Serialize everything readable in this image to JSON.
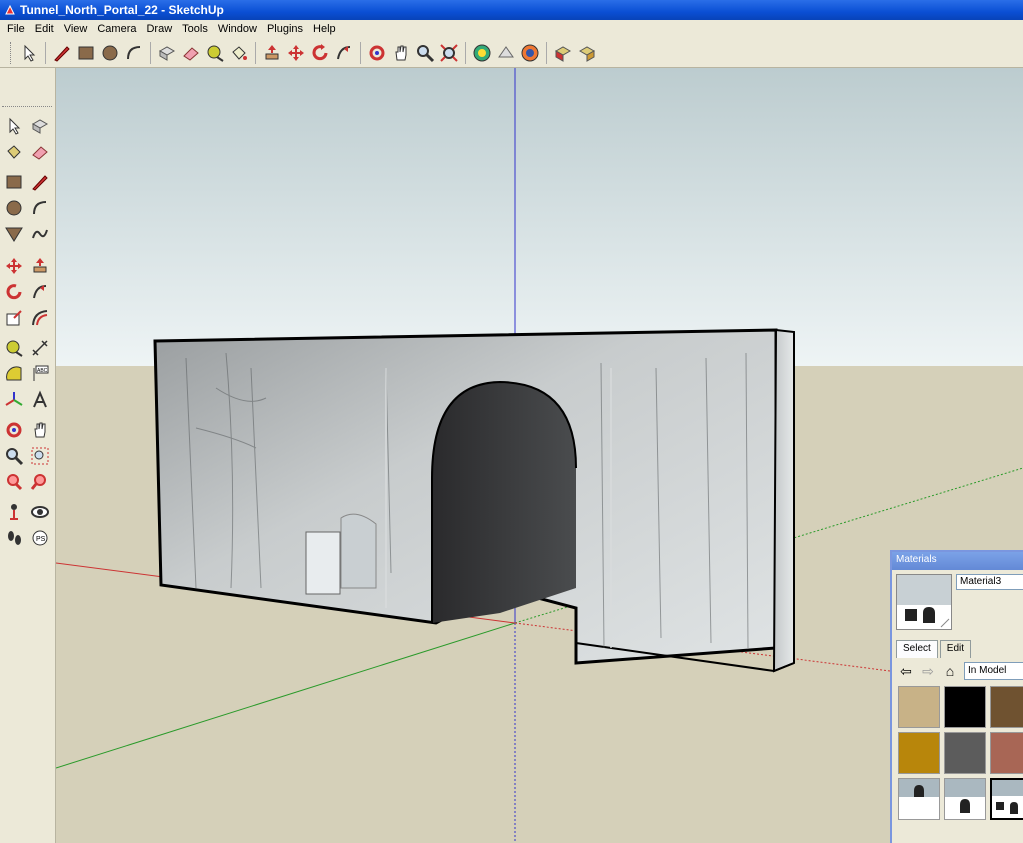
{
  "window": {
    "title": "Tunnel_North_Portal_22 - SketchUp"
  },
  "menu": [
    "File",
    "Edit",
    "View",
    "Camera",
    "Draw",
    "Tools",
    "Window",
    "Plugins",
    "Help"
  ],
  "toolbar_icons": [
    "select-icon",
    "pencil-icon",
    "rectangle-icon",
    "circle-icon",
    "arc-icon",
    "make-component-icon",
    "eraser-icon",
    "tape-measure-icon",
    "paint-bucket-icon",
    "push-pull-icon",
    "move-icon",
    "rotate-icon",
    "follow-me-icon",
    "orbit-icon",
    "pan-icon",
    "zoom-icon",
    "zoom-extents-icon",
    "get-models-icon",
    "share-model-icon",
    "google-earth-icon",
    "get-photo-texture-icon",
    "photo-texture-icon"
  ],
  "materials": {
    "panel_title": "Materials",
    "current_name": "Material3",
    "tabs": [
      "Select",
      "Edit"
    ],
    "collection": "In Model",
    "swatch_colors": [
      "#c8b287",
      "#000000",
      "#6f5230",
      "#b8860b",
      "#5c5c5c",
      "#a86655"
    ]
  }
}
